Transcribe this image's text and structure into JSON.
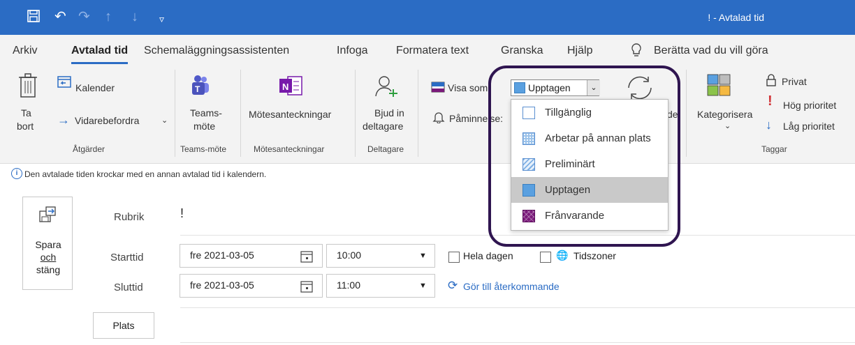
{
  "window": {
    "title": "! - Avtalad tid"
  },
  "ribbon_tabs": [
    "Arkiv",
    "Avtalad tid",
    "Schemaläggningsassistenten",
    "Infoga",
    "Formatera text",
    "Granska",
    "Hjälp",
    "Berätta vad du vill göra"
  ],
  "actions": {
    "delete_line1": "Ta",
    "delete_line2": "bort",
    "calendar": "Kalender",
    "forward": "Vidarebefordra",
    "group_label": "Åtgärder"
  },
  "teams": {
    "line1": "Teams-",
    "line2": "möte",
    "group_label": "Teams-möte"
  },
  "notes": {
    "label": "Mötesanteckningar",
    "group_label": "Mötesanteckningar"
  },
  "attendees": {
    "line1": "Bjud in",
    "line2": "deltagare",
    "group_label": "Deltagare"
  },
  "options": {
    "show_as_label": "Visa som:",
    "show_as_value": "Upptagen",
    "reminder_label": "Påminnelse:",
    "recurrence_partial": "de"
  },
  "tags": {
    "categorize": "Kategorisera",
    "private": "Privat",
    "high": "Hög prioritet",
    "low": "Låg prioritet",
    "group_label": "Taggar"
  },
  "info_message": "Den avtalade tiden krockar med en annan avtalad tid i kalendern.",
  "save_close": {
    "line1": "Spara",
    "line2": "och",
    "line3": "stäng"
  },
  "form": {
    "subject_label": "Rubrik",
    "subject_value": "!",
    "start_label": "Starttid",
    "end_label": "Sluttid",
    "start_date": "fre 2021-03-05",
    "start_time": "10:00",
    "end_date": "fre 2021-03-05",
    "end_time": "11:00",
    "all_day": "Hela dagen",
    "time_zones": "Tidszoner",
    "recurring": "Gör till återkommande",
    "location_button": "Plats"
  },
  "show_as_options": [
    {
      "label": "Tillgänglig",
      "color": "#ffffff"
    },
    {
      "label": "Arbetar på annan plats",
      "color": "#9cc3ea"
    },
    {
      "label": "Preliminärt",
      "color": "#c9ddf3"
    },
    {
      "label": "Upptagen",
      "color": "#5aa0e0"
    },
    {
      "label": "Frånvarande",
      "color": "#7a1a7a"
    }
  ],
  "colors": {
    "accent": "#2b6cc4",
    "highlight": "#c9c9c9",
    "annotation": "#2f1550"
  }
}
